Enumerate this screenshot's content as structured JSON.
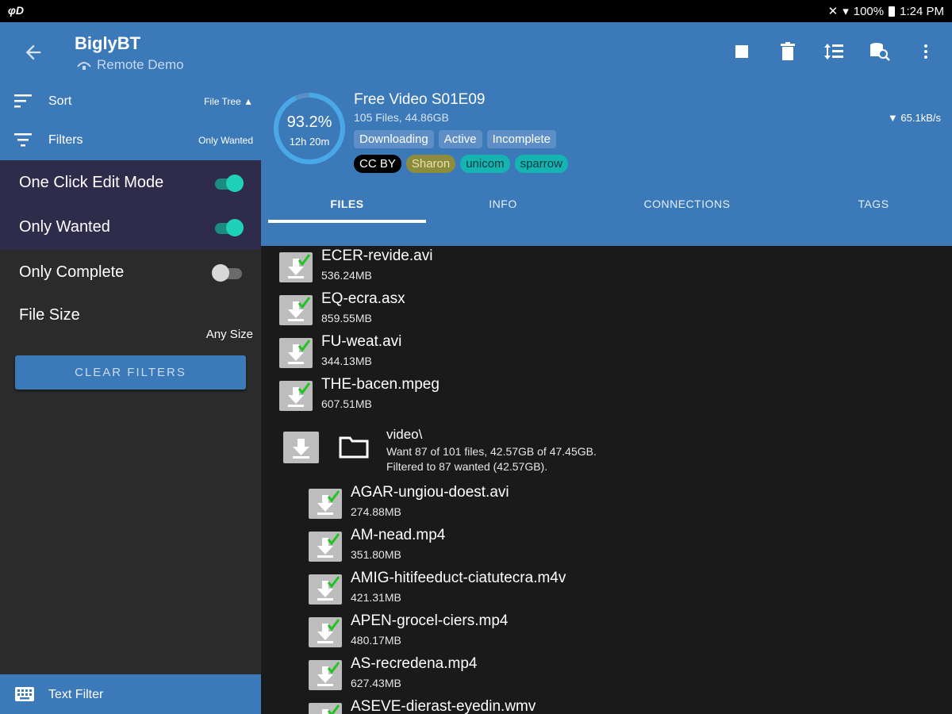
{
  "status_bar": {
    "left_icon": "φD",
    "battery": "100%",
    "time": "1:24 PM"
  },
  "appbar": {
    "title": "BiglyBT",
    "subtitle": "Remote Demo"
  },
  "sidebar": {
    "sort_label": "Sort",
    "sort_value": "File Tree ▲",
    "filters_label": "Filters",
    "filters_value": "Only Wanted",
    "toggles": [
      {
        "label": "One Click Edit Mode",
        "on": true
      },
      {
        "label": "Only Wanted",
        "on": true
      },
      {
        "label": "Only Complete",
        "on": false
      }
    ],
    "file_size_label": "File Size",
    "file_size_value": "Any Size",
    "clear_filters": "CLEAR FILTERS",
    "text_filter": "Text Filter"
  },
  "torrent": {
    "progress": "93.2%",
    "progress_fraction": 0.932,
    "eta": "12h 20m",
    "name": "Free Video S01E09",
    "info": "105 Files, 44.86GB",
    "speed": "▼ 65.1kB/s",
    "states": [
      "Downloading",
      "Active",
      "Incomplete"
    ],
    "tags": [
      {
        "label": "CC BY",
        "bg": "#000000",
        "fg": "#ffffff"
      },
      {
        "label": "Sharon",
        "bg": "#8c8c3c",
        "fg": "#e8e2b0"
      },
      {
        "label": "unicom",
        "bg": "#16b3b3",
        "fg": "#0b3b3b"
      },
      {
        "label": "sparrow",
        "bg": "#16b3b3",
        "fg": "#0b3b3b"
      }
    ]
  },
  "tabs": [
    "FILES",
    "INFO",
    "CONNECTIONS",
    "TAGS"
  ],
  "files_top": [
    {
      "name": "ECER-revide.avi",
      "size": "536.24MB"
    },
    {
      "name": "EQ-ecra.asx",
      "size": "859.55MB"
    },
    {
      "name": "FU-weat.avi",
      "size": "344.13MB"
    },
    {
      "name": "THE-bacen.mpeg",
      "size": "607.51MB"
    }
  ],
  "folder": {
    "name": "video\\",
    "line1": "Want 87 of 101 files, 42.57GB of 47.45GB.",
    "line2": "Filtered to 87 wanted (42.57GB)."
  },
  "files_folder": [
    {
      "name": "AGAR-ungiou-doest.avi",
      "size": "274.88MB"
    },
    {
      "name": "AM-nead.mp4",
      "size": "351.80MB"
    },
    {
      "name": "AMIG-hitifeeduct-ciatutecra.m4v",
      "size": "421.31MB"
    },
    {
      "name": "APEN-grocel-ciers.mp4",
      "size": "480.17MB"
    },
    {
      "name": "AS-recredena.mp4",
      "size": "627.43MB"
    },
    {
      "name": "ASEVE-dierast-eyedin.wmv",
      "size": ""
    }
  ],
  "colors": {
    "primary": "#3b79b9",
    "accent": "#1fd1b8",
    "dark_panel": "#2e2c4a",
    "check": "#21c321"
  },
  "icons": [
    "back-arrow-icon",
    "stop-icon",
    "delete-icon",
    "sort-order-icon",
    "search-db-icon",
    "more-vert-icon",
    "sort-icon",
    "filter-icon",
    "text-filter-icon",
    "folder-icon",
    "download-check-icon"
  ]
}
